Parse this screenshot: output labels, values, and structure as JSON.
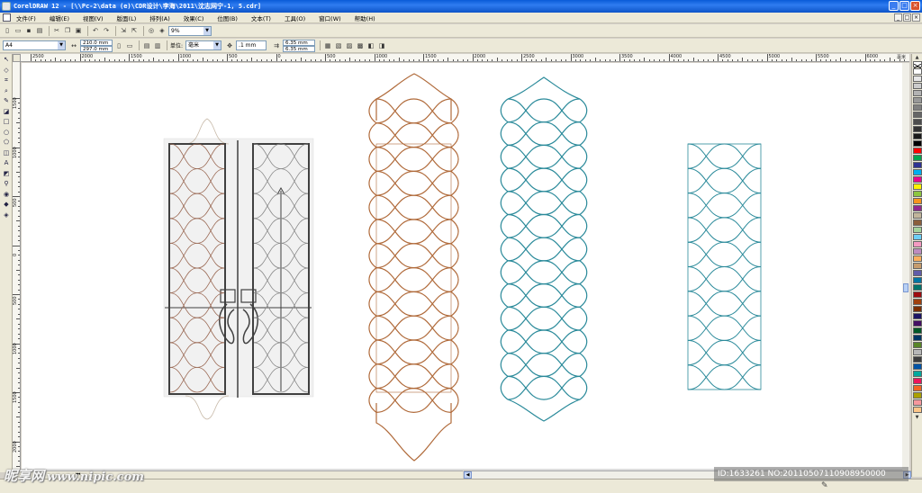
{
  "window": {
    "title": "CorelDRAW 12 - [\\\\Pc-2\\data (e)\\CDR设计\\李海\\2011\\沈志网宁-1, 5.cdr]",
    "minimize": "_",
    "maximize": "□",
    "close": "×"
  },
  "menu": {
    "items": [
      "文件(F)",
      "编辑(E)",
      "视图(V)",
      "版面(L)",
      "排列(A)",
      "效果(C)",
      "位图(B)",
      "文本(T)",
      "工具(O)",
      "窗口(W)",
      "帮助(H)"
    ]
  },
  "toolbar": {
    "zoom_value": "9%"
  },
  "propbar": {
    "page_size": "A4",
    "width": "210.0 mm",
    "height": "297.0 mm",
    "unit_label": "单位:",
    "unit_value": "毫米",
    "nudge": ".1 mm",
    "dup_x": "6.35 mm",
    "dup_y": "6.35 mm"
  },
  "ruler": {
    "h_labels": [
      "2500",
      "2000",
      "1500",
      "1000",
      "500",
      "0",
      "500",
      "1000",
      "1500",
      "2000",
      "2500",
      "3000",
      "3500",
      "4000",
      "4500",
      "5000",
      "5500",
      "6000"
    ],
    "h_unit": "毫米",
    "v_labels": [
      "1500",
      "1000",
      "500",
      "0",
      "500",
      "1000",
      "1500",
      "2000"
    ]
  },
  "palette": {
    "colors": [
      "#ffffff",
      "#e6e6e6",
      "#cccccc",
      "#b3b3b3",
      "#999999",
      "#808080",
      "#666666",
      "#4d4d4d",
      "#333333",
      "#1a1a1a",
      "#000000",
      "#ff0000",
      "#00a651",
      "#2e3192",
      "#00aeef",
      "#ec008c",
      "#fff200",
      "#8dc63f",
      "#f7941d",
      "#92278f",
      "#c2b59b",
      "#8b5e3c",
      "#a3d39c",
      "#6dcff6",
      "#f49ac1",
      "#bd8cbf",
      "#fbaf5d",
      "#c69c6d",
      "#605ca8",
      "#0076a3",
      "#00746b",
      "#9e0b0f",
      "#a0410d",
      "#7b2e00",
      "#1b1464",
      "#440e62",
      "#005826",
      "#003663",
      "#598527",
      "#b7b7b7",
      "#3d3d3d",
      "#0054a6",
      "#00a99d",
      "#ed145b",
      "#f26522",
      "#aba000",
      "#f6989d",
      "#fdc689"
    ]
  },
  "watermark": {
    "brand": "昵享网",
    "url": "www.nipic.com"
  },
  "id_text": "ID:1633261 NO:20110507110908950000"
}
